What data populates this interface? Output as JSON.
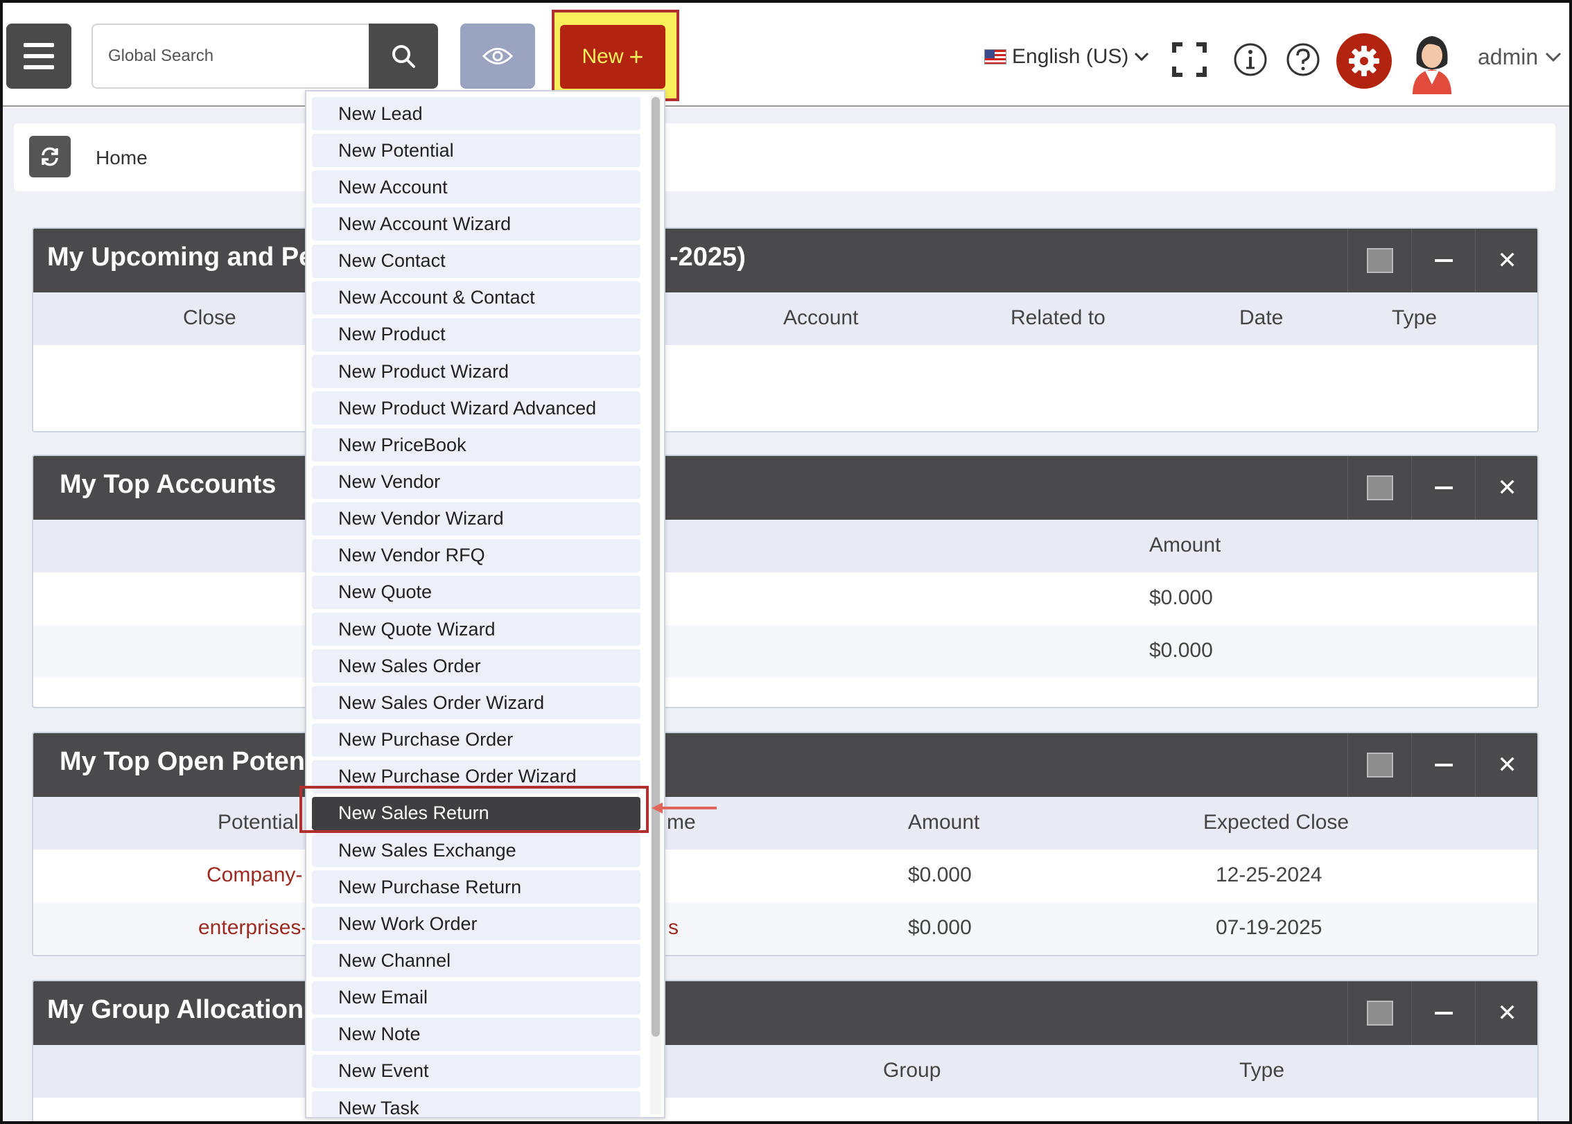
{
  "header": {
    "search_placeholder": "Global Search",
    "new_label": "New",
    "new_plus": "+",
    "language": "English (US)",
    "username": "admin"
  },
  "breadcrumb": {
    "home": "Home"
  },
  "widgets": {
    "upcoming": {
      "title_left": "My Upcoming and Per",
      "title_right": "-2025)",
      "columns": [
        "Close",
        "Account",
        "Related to",
        "Date",
        "Type"
      ]
    },
    "top_accounts": {
      "title": "My Top Accounts",
      "columns": [
        "Amount"
      ],
      "rows": [
        {
          "amount": "$0.000"
        },
        {
          "amount": "$0.000"
        }
      ]
    },
    "top_potentials": {
      "title": "My Top Open Potenti",
      "columns": [
        "Potential",
        "me",
        "Amount",
        "Expected Close"
      ],
      "rows": [
        {
          "potential": "Company-",
          "amount": "$0.000",
          "expected_close": "12-25-2024",
          "extra": ""
        },
        {
          "potential": "enterprises-",
          "amount": "$0.000",
          "expected_close": "07-19-2025",
          "extra": "s"
        }
      ]
    },
    "group_allocation": {
      "title": "My Group Allocation",
      "columns": [
        "Group",
        "Type"
      ]
    }
  },
  "new_menu": {
    "items": [
      "New Lead",
      "New Potential",
      "New Account",
      "New Account Wizard",
      "New Contact",
      "New Account & Contact",
      "New Product",
      "New Product Wizard",
      "New Product Wizard Advanced",
      "New PriceBook",
      "New Vendor",
      "New Vendor Wizard",
      "New Vendor RFQ",
      "New Quote",
      "New Quote Wizard",
      "New Sales Order",
      "New Sales Order Wizard",
      "New Purchase Order",
      "New Purchase Order Wizard",
      "New Sales Return",
      "New Sales Exchange",
      "New Purchase Return",
      "New Work Order",
      "New Channel",
      "New Email",
      "New Note",
      "New Event",
      "New Task"
    ],
    "active_item": "New Sales Return"
  },
  "colors": {
    "accent_red": "#b2240f",
    "highlight_yellow": "#f7ef5c",
    "header_dark": "#4a4a4c"
  }
}
